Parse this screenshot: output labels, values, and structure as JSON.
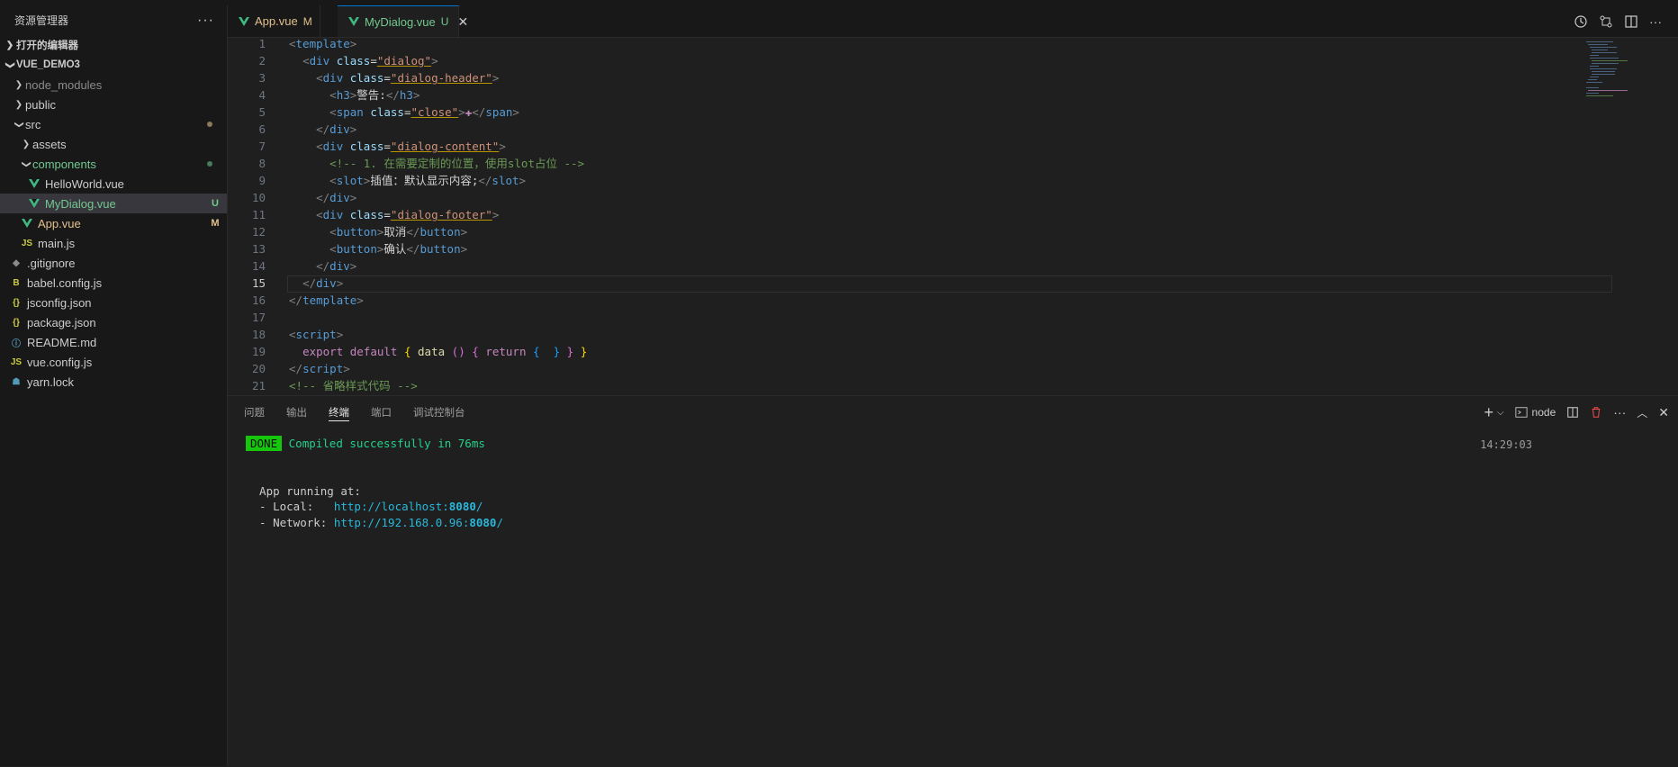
{
  "explorer": {
    "title": "资源管理器",
    "more": "···",
    "open_editors": "打开的编辑器",
    "project": "VUE_DEMO3",
    "tree": [
      {
        "label": "node_modules",
        "kind": "folder",
        "state": "collapsed",
        "color": "#8b8b8b"
      },
      {
        "label": "public",
        "kind": "folder",
        "state": "collapsed",
        "color": "#cccccc"
      },
      {
        "label": "src",
        "kind": "folder",
        "state": "expanded",
        "color": "#cccccc",
        "status": "modified-dot"
      },
      {
        "label": "assets",
        "kind": "folder",
        "state": "collapsed",
        "color": "#cccccc"
      },
      {
        "label": "components",
        "kind": "folder",
        "state": "expanded",
        "color": "#73c991",
        "status": "untracked-dot"
      },
      {
        "label": "HelloWorld.vue",
        "kind": "vue",
        "color": "#cccccc"
      },
      {
        "label": "MyDialog.vue",
        "kind": "vue",
        "color": "#73c991",
        "badge": "U"
      },
      {
        "label": "App.vue",
        "kind": "vue",
        "color": "#e2c08d",
        "badge": "M"
      },
      {
        "label": "main.js",
        "kind": "js",
        "icon_text": "JS",
        "color": "#cccccc"
      },
      {
        "label": ".gitignore",
        "kind": "git",
        "icon_text": "◆",
        "color": "#cccccc"
      },
      {
        "label": "babel.config.js",
        "kind": "babel",
        "icon_text": "B",
        "color": "#cccccc"
      },
      {
        "label": "jsconfig.json",
        "kind": "json",
        "icon_text": "{}",
        "color": "#cccccc"
      },
      {
        "label": "package.json",
        "kind": "json",
        "icon_text": "{}",
        "color": "#cccccc"
      },
      {
        "label": "README.md",
        "kind": "info",
        "icon_text": "ⓘ",
        "color": "#cccccc"
      },
      {
        "label": "vue.config.js",
        "kind": "js",
        "icon_text": "JS",
        "color": "#cccccc"
      },
      {
        "label": "yarn.lock",
        "kind": "yarn",
        "icon_text": "☗",
        "color": "#cccccc"
      }
    ]
  },
  "tabs": [
    {
      "label": "App.vue",
      "status": "M",
      "status_color": "#e2c08d",
      "label_color": "#e2c08d"
    },
    {
      "label": "MyDialog.vue",
      "status": "U",
      "status_color": "#73c991",
      "label_color": "#73c991",
      "close": "✕"
    }
  ],
  "editor": {
    "current_line": 15,
    "lines": [
      {
        "n": "1",
        "indent": "",
        "segs": [
          [
            "tg",
            "<"
          ],
          [
            "tn",
            "template"
          ],
          [
            "tg",
            ">"
          ]
        ]
      },
      {
        "n": "2",
        "indent": "  ",
        "segs": [
          [
            "tg",
            "<"
          ],
          [
            "tn",
            "div"
          ],
          [
            "tx",
            " "
          ],
          [
            "at",
            "class"
          ],
          [
            "tx",
            "="
          ],
          [
            "sv",
            "\"dialog\""
          ],
          [
            "tg",
            ">"
          ]
        ]
      },
      {
        "n": "3",
        "indent": "    ",
        "segs": [
          [
            "tg",
            "<"
          ],
          [
            "tn",
            "div"
          ],
          [
            "tx",
            " "
          ],
          [
            "at",
            "class"
          ],
          [
            "tx",
            "="
          ],
          [
            "sv",
            "\"dialog-header\""
          ],
          [
            "tg",
            ">"
          ]
        ]
      },
      {
        "n": "4",
        "indent": "      ",
        "segs": [
          [
            "tg",
            "<"
          ],
          [
            "tn",
            "h3"
          ],
          [
            "tg",
            ">"
          ],
          [
            "tx",
            "警告:"
          ],
          [
            "tg",
            "</"
          ],
          [
            "tn",
            "h3"
          ],
          [
            "tg",
            ">"
          ]
        ]
      },
      {
        "n": "5",
        "indent": "      ",
        "segs": [
          [
            "tg",
            "<"
          ],
          [
            "tn",
            "span"
          ],
          [
            "tx",
            " "
          ],
          [
            "at",
            "class"
          ],
          [
            "tx",
            "="
          ],
          [
            "sv",
            "\"close\""
          ],
          [
            "tg",
            ">"
          ],
          [
            "kw",
            "✚"
          ],
          [
            "tg",
            "</"
          ],
          [
            "tn",
            "span"
          ],
          [
            "tg",
            ">"
          ]
        ]
      },
      {
        "n": "6",
        "indent": "    ",
        "segs": [
          [
            "tg",
            "</"
          ],
          [
            "tn",
            "div"
          ],
          [
            "tg",
            ">"
          ]
        ]
      },
      {
        "n": "7",
        "indent": "    ",
        "segs": [
          [
            "tg",
            "<"
          ],
          [
            "tn",
            "div"
          ],
          [
            "tx",
            " "
          ],
          [
            "at",
            "class"
          ],
          [
            "tx",
            "="
          ],
          [
            "sv",
            "\"dialog-content\""
          ],
          [
            "tg",
            ">"
          ]
        ]
      },
      {
        "n": "8",
        "indent": "      ",
        "segs": [
          [
            "cm",
            "<!-- 1. 在需要定制的位置，使用slot占位 -->"
          ]
        ]
      },
      {
        "n": "9",
        "indent": "      ",
        "segs": [
          [
            "tg",
            "<"
          ],
          [
            "tn",
            "slot"
          ],
          [
            "tg",
            ">"
          ],
          [
            "tx",
            "插值：默认显示内容;"
          ],
          [
            "tg",
            "</"
          ],
          [
            "tn",
            "slot"
          ],
          [
            "tg",
            ">"
          ]
        ]
      },
      {
        "n": "10",
        "indent": "    ",
        "segs": [
          [
            "tg",
            "</"
          ],
          [
            "tn",
            "div"
          ],
          [
            "tg",
            ">"
          ]
        ]
      },
      {
        "n": "11",
        "indent": "    ",
        "segs": [
          [
            "tg",
            "<"
          ],
          [
            "tn",
            "div"
          ],
          [
            "tx",
            " "
          ],
          [
            "at",
            "class"
          ],
          [
            "tx",
            "="
          ],
          [
            "sv",
            "\"dialog-footer\""
          ],
          [
            "tg",
            ">"
          ]
        ]
      },
      {
        "n": "12",
        "indent": "      ",
        "segs": [
          [
            "tg",
            "<"
          ],
          [
            "tn",
            "button"
          ],
          [
            "tg",
            ">"
          ],
          [
            "tx",
            "取消"
          ],
          [
            "tg",
            "</"
          ],
          [
            "tn",
            "button"
          ],
          [
            "tg",
            ">"
          ]
        ]
      },
      {
        "n": "13",
        "indent": "      ",
        "segs": [
          [
            "tg",
            "<"
          ],
          [
            "tn",
            "button"
          ],
          [
            "tg",
            ">"
          ],
          [
            "tx",
            "确认"
          ],
          [
            "tg",
            "</"
          ],
          [
            "tn",
            "button"
          ],
          [
            "tg",
            ">"
          ]
        ]
      },
      {
        "n": "14",
        "indent": "    ",
        "segs": [
          [
            "tg",
            "</"
          ],
          [
            "tn",
            "div"
          ],
          [
            "tg",
            ">"
          ]
        ]
      },
      {
        "n": "15",
        "indent": "  ",
        "segs": [
          [
            "tg",
            "</"
          ],
          [
            "tn",
            "div"
          ],
          [
            "tg",
            ">"
          ]
        ]
      },
      {
        "n": "16",
        "indent": "",
        "segs": [
          [
            "tg",
            "</"
          ],
          [
            "tn",
            "template"
          ],
          [
            "tg",
            ">"
          ]
        ]
      },
      {
        "n": "17",
        "indent": "",
        "segs": []
      },
      {
        "n": "18",
        "indent": "",
        "segs": [
          [
            "tg",
            "<"
          ],
          [
            "tn",
            "script"
          ],
          [
            "tg",
            ">"
          ]
        ]
      },
      {
        "n": "19",
        "indent": "  ",
        "segs": [
          [
            "kw",
            "export"
          ],
          [
            "tx",
            " "
          ],
          [
            "kw",
            "default"
          ],
          [
            "tx",
            " "
          ],
          [
            "br",
            "{"
          ],
          [
            "tx",
            " "
          ],
          [
            "fn",
            "data"
          ],
          [
            "tx",
            " "
          ],
          [
            "br2",
            "()"
          ],
          [
            "tx",
            " "
          ],
          [
            "br2",
            "{"
          ],
          [
            "tx",
            " "
          ],
          [
            "kw",
            "return"
          ],
          [
            "tx",
            " "
          ],
          [
            "br3",
            "{"
          ],
          [
            "tx",
            "  "
          ],
          [
            "br3",
            "}"
          ],
          [
            "tx",
            " "
          ],
          [
            "br2",
            "}"
          ],
          [
            "tx",
            " "
          ],
          [
            "br",
            "}"
          ]
        ]
      },
      {
        "n": "20",
        "indent": "",
        "segs": [
          [
            "tg",
            "</"
          ],
          [
            "tn",
            "script"
          ],
          [
            "tg",
            ">"
          ]
        ]
      },
      {
        "n": "21",
        "indent": "",
        "segs": [
          [
            "cm",
            "<!-- 省略样式代码 -->"
          ]
        ]
      }
    ]
  },
  "panel": {
    "tabs": [
      "问题",
      "输出",
      "终端",
      "端口",
      "调试控制台"
    ],
    "active_tab": "终端",
    "terminal_name": "node",
    "time": "14:29:03",
    "done_badge": "DONE",
    "compiled": "Compiled successfully in 76ms",
    "app_running": "  App running at:",
    "local_label": "  - Local:   ",
    "local_url": "http://localhost:",
    "local_port": "8080",
    "network_label": "  - Network: ",
    "network_url": "http://192.168.0.96:",
    "network_port": "8080",
    "slash": "/"
  }
}
